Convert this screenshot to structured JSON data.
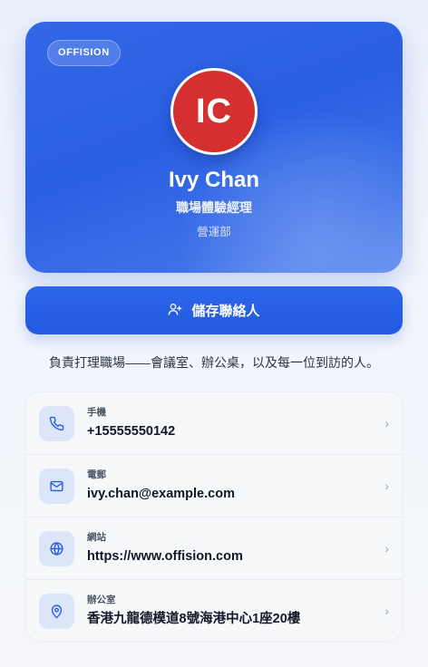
{
  "brand": {
    "badge": "OFFISION"
  },
  "profile": {
    "initials": "IC",
    "name": "Ivy Chan",
    "title": "職場體驗經理",
    "department": "營運部"
  },
  "actions": {
    "save_label": "儲存聯絡人"
  },
  "bio": "負責打理職場——會議室、辦公桌，以及每一位到訪的人。",
  "contacts": [
    {
      "icon": "phone-icon",
      "label": "手機",
      "value": "+15555550142"
    },
    {
      "icon": "mail-icon",
      "label": "電郵",
      "value": "ivy.chan@example.com"
    },
    {
      "icon": "globe-icon",
      "label": "網站",
      "value": "https://www.offision.com"
    },
    {
      "icon": "location-pin-icon",
      "label": "辦公室",
      "value": "香港九龍德模道8號海港中心1座20樓"
    }
  ],
  "chevron": "›",
  "colors": {
    "accent": "#2a5fe3",
    "avatar": "#d62f2f",
    "icon_tint": "#2a5fe3",
    "icon_bg": "#dde6f8"
  }
}
